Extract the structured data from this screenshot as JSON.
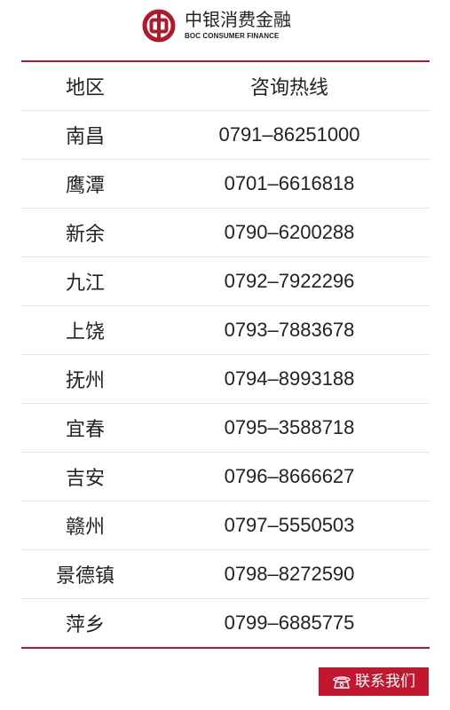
{
  "header": {
    "brand_name": "中银消费金融",
    "brand_sub": "BOC CONSUMER FINANCE",
    "logo_icon": "boc-logo-icon"
  },
  "colors": {
    "brand_red": "#b2182b",
    "button_red": "#c2172e"
  },
  "table": {
    "columns": [
      "地区",
      "咨询热线"
    ],
    "rows": [
      {
        "region": "南昌",
        "phone": "0791–86251000"
      },
      {
        "region": "鹰潭",
        "phone": "0701–6616818"
      },
      {
        "region": "新余",
        "phone": "0790–6200288"
      },
      {
        "region": "九江",
        "phone": "0792–7922296"
      },
      {
        "region": "上饶",
        "phone": "0793–7883678"
      },
      {
        "region": "抚州",
        "phone": "0794–8993188"
      },
      {
        "region": "宜春",
        "phone": "0795–3588718"
      },
      {
        "region": "吉安",
        "phone": "0796–8666627"
      },
      {
        "region": "赣州",
        "phone": "0797–5550503"
      },
      {
        "region": "景德镇",
        "phone": "0798–8272590"
      },
      {
        "region": "萍乡",
        "phone": "0799–6885775"
      }
    ]
  },
  "contact_button": {
    "label": "联系我们",
    "icon": "telephone-icon"
  }
}
